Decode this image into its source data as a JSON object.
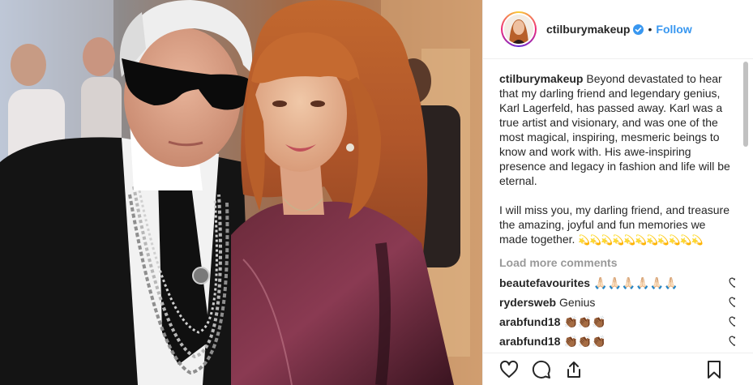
{
  "post": {
    "username": "ctilburymakeup",
    "verified": true,
    "separator": "•",
    "follow_label": "Follow",
    "caption": {
      "username": "ctilburymakeup",
      "text_1": "Beyond devastated to hear that my darling friend and legendary genius, Karl Lagerfeld, has passed away. Karl was a true artist and visionary, and was one of the most magical, inspiring, mesmeric beings to know and work with. His awe-inspiring presence and legacy in fashion and life will be eternal.",
      "text_2": "I will miss you, my darling friend, and treasure the amazing, joyful and fun memories we made together.",
      "emoji_tail": "💫💫💫💫💫💫💫💫💫💫💫"
    },
    "load_more_label": "Load more comments",
    "comments": [
      {
        "user": "beautefavourites",
        "text": "🙏🏻🙏🏻🙏🏻🙏🏻🙏🏻🙏🏻"
      },
      {
        "user": "rydersweb",
        "text": "Genius"
      },
      {
        "user": "arabfund18",
        "text": "👏🏾👏🏾👏🏾"
      },
      {
        "user": "arabfund18",
        "text": "👏🏾👏🏾👏🏾"
      }
    ]
  },
  "icons": {
    "like": "heart-icon",
    "comment": "comment-icon",
    "share": "share-icon",
    "save": "bookmark-icon",
    "verified": "verified-badge-icon"
  },
  "colors": {
    "accent": "#3897f0",
    "muted": "#999999",
    "text": "#262626",
    "border": "#efefef"
  }
}
